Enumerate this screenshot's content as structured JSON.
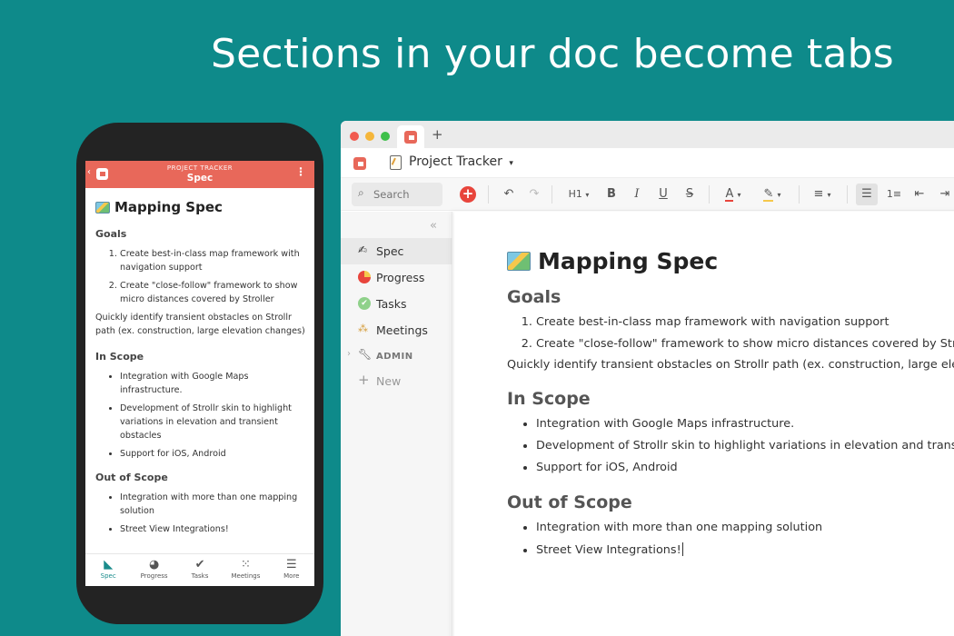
{
  "headline": "Sections in your doc become tabs",
  "mobile": {
    "project_label": "PROJECT TRACKER",
    "page_label": "Spec",
    "doc_title": "Mapping Spec",
    "goals_heading": "Goals",
    "goals": [
      "Create best-in-class map framework with navigation support",
      "Create \"close-follow\" framework to show micro distances covered by Stroller"
    ],
    "goals_note": "Quickly identify transient obstacles on Strollr path (ex. construction, large elevation changes)",
    "inscope_heading": "In Scope",
    "inscope": [
      "Integration with Google Maps infrastructure.",
      "Development of Strollr skin to highlight variations in elevation and transient obstacles",
      "Support for iOS, Android"
    ],
    "outscope_heading": "Out of Scope",
    "outscope": [
      "Integration with more than one mapping solution",
      "Street View Integrations!"
    ],
    "tabs": [
      "Spec",
      "Progress",
      "Tasks",
      "Meetings",
      "More"
    ]
  },
  "desktop": {
    "doc_name": "Project Tracker",
    "search_placeholder": "Search",
    "heading_control": "H1",
    "sidebar": {
      "spec": "Spec",
      "progress": "Progress",
      "tasks": "Tasks",
      "meetings": "Meetings",
      "admin": "ADMIN",
      "new": "New"
    },
    "doc_title": "Mapping Spec",
    "goals_heading": "Goals",
    "goals": [
      "Create best-in-class map framework with navigation support",
      "Create \"close-follow\" framework to show micro distances covered by Stroller"
    ],
    "goals_note": "Quickly identify transient obstacles on Strollr path (ex. construction, large elevation changes)",
    "inscope_heading": "In Scope",
    "inscope": [
      "Integration with Google Maps infrastructure.",
      "Development of Strollr skin to highlight variations in elevation and transient obstacles",
      "Support for iOS, Android"
    ],
    "outscope_heading": "Out of Scope",
    "outscope": [
      "Integration with more than one mapping solution",
      "Street View Integrations!"
    ]
  },
  "colors": {
    "background": "#0e8a8a",
    "brand_coral": "#e8685a",
    "accent_teal": "#1a8c8c"
  }
}
